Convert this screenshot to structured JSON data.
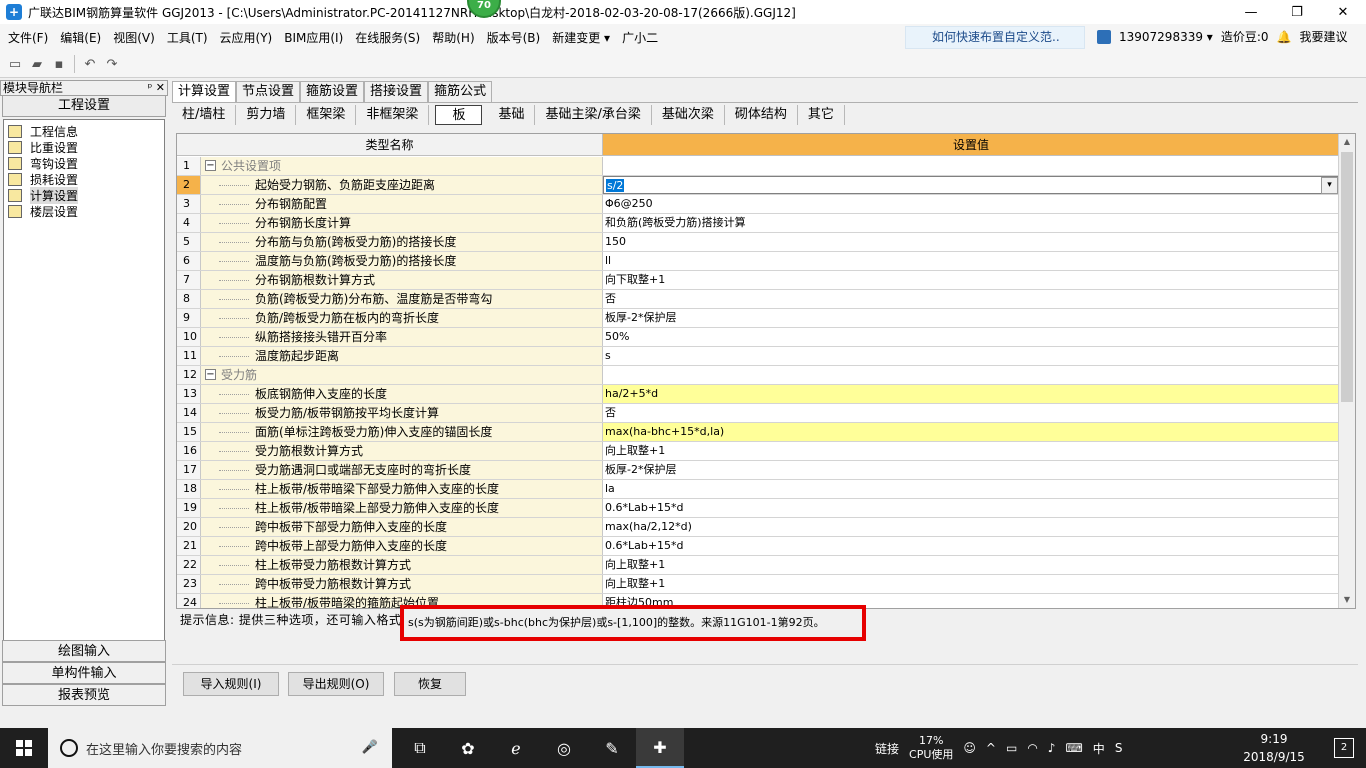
{
  "window": {
    "title": "广联达BIM钢筋算量软件 GGJ2013 - [C:\\Users\\Administrator.PC-20141127NRHI...sktop\\白龙村-2018-02-03-20-08-17(2666版).GGJ12]",
    "badge": "70",
    "minimize": "—",
    "restore": "❐",
    "close": "✕"
  },
  "menu": {
    "items": [
      "文件(F)",
      "编辑(E)",
      "视图(V)",
      "工具(T)",
      "云应用(Y)",
      "BIM应用(I)",
      "在线服务(S)",
      "帮助(H)",
      "版本号(B)",
      "新建变更 ▾",
      "广小二"
    ],
    "tip": "如何快速布置自定义范..",
    "user": "13907298339 ▾",
    "bean": "造价豆:0",
    "suggest": "我要建议"
  },
  "toolbar": {
    "icons": [
      "new-icon",
      "open-icon",
      "save-icon",
      "undo-icon",
      "redo-icon"
    ]
  },
  "nav": {
    "header": "模块导航栏",
    "pins": "ᵖ ✕",
    "section": "工程设置",
    "items": [
      "工程信息",
      "比重设置",
      "弯钩设置",
      "损耗设置",
      "计算设置",
      "楼层设置"
    ],
    "selected_index": 4,
    "bottom": [
      "绘图输入",
      "单构件输入",
      "报表预览"
    ]
  },
  "tabs": [
    "计算设置",
    "节点设置",
    "箍筋设置",
    "搭接设置",
    "箍筋公式"
  ],
  "active_tab": 0,
  "subtabs": [
    "柱/墙柱",
    "剪力墙",
    "框架梁",
    "非框架梁",
    "板",
    "基础",
    "基础主梁/承台梁",
    "基础次梁",
    "砌体结构",
    "其它"
  ],
  "active_subtab": 4,
  "grid": {
    "col_name": "类型名称",
    "col_value": "设置值",
    "rows": [
      {
        "n": "1",
        "name": "公共设置项",
        "value": "",
        "group": true
      },
      {
        "n": "2",
        "name": "起始受力钢筋、负筋距支座边距离",
        "value": "s/2",
        "editing": true
      },
      {
        "n": "3",
        "name": "分布钢筋配置",
        "value": "Φ6@250"
      },
      {
        "n": "4",
        "name": "分布钢筋长度计算",
        "value": "和负筋(跨板受力筋)搭接计算"
      },
      {
        "n": "5",
        "name": "分布筋与负筋(跨板受力筋)的搭接长度",
        "value": "150"
      },
      {
        "n": "6",
        "name": "温度筋与负筋(跨板受力筋)的搭接长度",
        "value": "ll"
      },
      {
        "n": "7",
        "name": "分布钢筋根数计算方式",
        "value": "向下取整+1"
      },
      {
        "n": "8",
        "name": "负筋(跨板受力筋)分布筋、温度筋是否带弯勾",
        "value": "否"
      },
      {
        "n": "9",
        "name": "负筋/跨板受力筋在板内的弯折长度",
        "value": "板厚-2*保护层"
      },
      {
        "n": "10",
        "name": "纵筋搭接接头错开百分率",
        "value": "50%"
      },
      {
        "n": "11",
        "name": "温度筋起步距离",
        "value": "s"
      },
      {
        "n": "12",
        "name": "受力筋",
        "value": "",
        "group": true
      },
      {
        "n": "13",
        "name": "板底钢筋伸入支座的长度",
        "value": "ha/2+5*d",
        "highlight": true
      },
      {
        "n": "14",
        "name": "板受力筋/板带钢筋按平均长度计算",
        "value": "否"
      },
      {
        "n": "15",
        "name": "面筋(单标注跨板受力筋)伸入支座的锚固长度",
        "value": "max(ha-bhc+15*d,la)",
        "highlight": true
      },
      {
        "n": "16",
        "name": "受力筋根数计算方式",
        "value": "向上取整+1"
      },
      {
        "n": "17",
        "name": "受力筋遇洞口或端部无支座时的弯折长度",
        "value": "板厚-2*保护层"
      },
      {
        "n": "18",
        "name": "柱上板带/板带暗梁下部受力筋伸入支座的长度",
        "value": "la"
      },
      {
        "n": "19",
        "name": "柱上板带/板带暗梁上部受力筋伸入支座的长度",
        "value": "0.6*Lab+15*d"
      },
      {
        "n": "20",
        "name": "跨中板带下部受力筋伸入支座的长度",
        "value": "max(ha/2,12*d)"
      },
      {
        "n": "21",
        "name": "跨中板带上部受力筋伸入支座的长度",
        "value": "0.6*Lab+15*d"
      },
      {
        "n": "22",
        "name": "柱上板带受力筋根数计算方式",
        "value": "向上取整+1"
      },
      {
        "n": "23",
        "name": "跨中板带受力筋根数计算方式",
        "value": "向上取整+1"
      },
      {
        "n": "24",
        "name": "柱上板带/板带暗梁的箍筋起始位置",
        "value": "距柱边50mm"
      }
    ]
  },
  "hint": {
    "label": "提示信息: 提供三种选项，还可输入格式",
    "text": "s(s为钢筋间距)或s-bhc(bhc为保护层)或s-[1,100]的整数。来源11G101-1第92页。"
  },
  "buttons": {
    "import": "导入规则(I)",
    "export": "导出规则(O)",
    "restore": "恢复"
  },
  "taskbar": {
    "search_placeholder": "在这里输入你要搜索的内容",
    "link": "链接",
    "cpu_pct": "17%",
    "cpu_label": "CPU使用",
    "ime": "中",
    "time": "9:19",
    "date": "2018/9/15",
    "notif": "2"
  },
  "colors": {
    "header_value": "#f5b24a",
    "highlight_row": "#ffff99",
    "name_col": "#fbf6dc",
    "hint_box": "#e60000"
  }
}
